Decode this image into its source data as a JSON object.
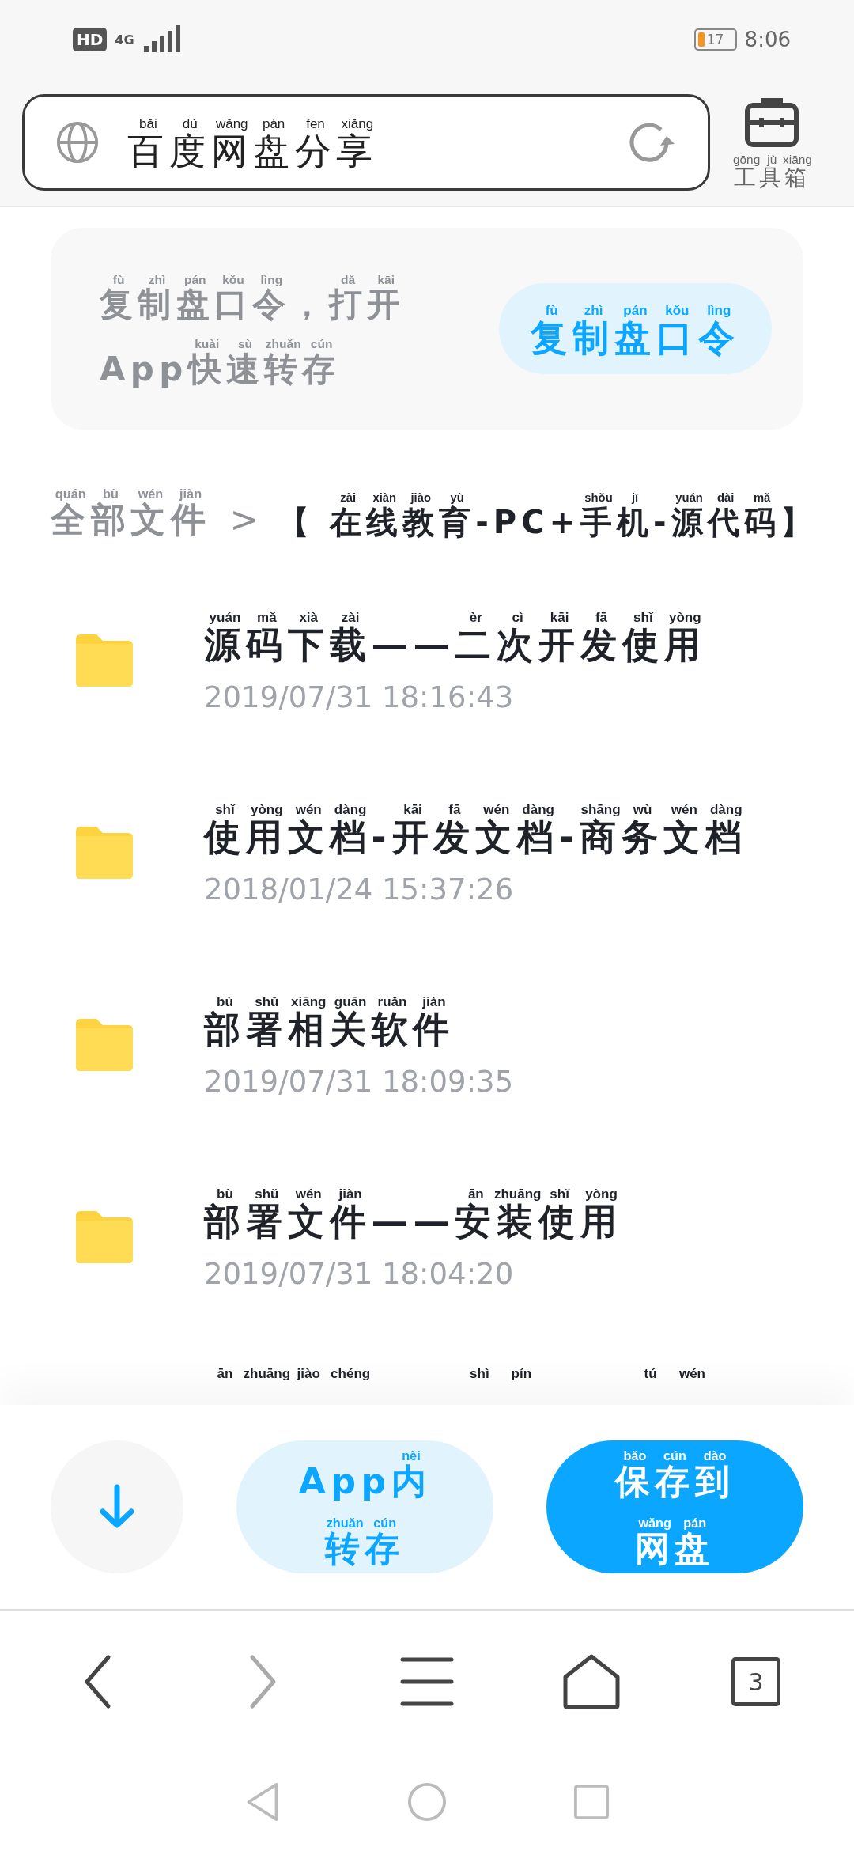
{
  "status_bar": {
    "hd": "HD",
    "network": "4G",
    "battery": "17",
    "time": "8:06"
  },
  "address_bar": {
    "title": [
      {
        "han": "百度网盘分享",
        "pinyin": [
          "bǎi",
          "dù",
          "wǎng",
          "pán",
          "fēn",
          "xiǎng"
        ]
      }
    ]
  },
  "toolbox": {
    "label": [
      {
        "han": "工具箱",
        "pinyin": [
          "gōng",
          "jù",
          "xiāng"
        ]
      }
    ]
  },
  "banner": {
    "lines": [
      [
        {
          "han": "复制盘口令",
          "pinyin": [
            "fù",
            "zhì",
            "pán",
            "kǒu",
            "lìng"
          ]
        },
        {
          "plain": "，"
        },
        {
          "han": "打开",
          "pinyin": [
            "dǎ",
            "kāi"
          ]
        }
      ],
      [
        {
          "plain": "App"
        },
        {
          "han": "快速转存",
          "pinyin": [
            "kuài",
            "sù",
            "zhuǎn",
            "cún"
          ]
        }
      ]
    ],
    "button": [
      {
        "han": "复制盘口令",
        "pinyin": [
          "fù",
          "zhì",
          "pán",
          "kǒu",
          "lìng"
        ]
      }
    ]
  },
  "breadcrumb": {
    "root": [
      {
        "han": "全部文件",
        "pinyin": [
          "quán",
          "bù",
          "wén",
          "jiàn"
        ]
      }
    ],
    "separator": ">",
    "current": [
      {
        "plain": "【 "
      },
      {
        "han": "在线教育",
        "pinyin": [
          "zài",
          "xiàn",
          "jiào",
          "yù"
        ]
      },
      {
        "plain": "-PC+"
      },
      {
        "han": "手机",
        "pinyin": [
          "shǒu",
          "jī"
        ]
      },
      {
        "plain": "-"
      },
      {
        "han": "源代码",
        "pinyin": [
          "yuán",
          "dài",
          "mǎ"
        ]
      },
      {
        "plain": "】"
      }
    ]
  },
  "files": [
    {
      "name": [
        {
          "han": "源码下载",
          "pinyin": [
            "yuán",
            "mǎ",
            "xià",
            "zài"
          ]
        },
        {
          "plain": "——"
        },
        {
          "han": "二次开发使用",
          "pinyin": [
            "èr",
            "cì",
            "kāi",
            "fā",
            "shǐ",
            "yòng"
          ]
        }
      ],
      "date": "2019/07/31 18:16:43"
    },
    {
      "name": [
        {
          "han": "使用文档",
          "pinyin": [
            "shǐ",
            "yòng",
            "wén",
            "dàng"
          ]
        },
        {
          "plain": "-"
        },
        {
          "han": "开发文档",
          "pinyin": [
            "kāi",
            "fā",
            "wén",
            "dàng"
          ]
        },
        {
          "plain": "-"
        },
        {
          "han": "商务文档",
          "pinyin": [
            "shāng",
            "wù",
            "wén",
            "dàng"
          ]
        }
      ],
      "date": "2018/01/24 15:37:26"
    },
    {
      "name": [
        {
          "han": "部署相关软件",
          "pinyin": [
            "bù",
            "shǔ",
            "xiāng",
            "guān",
            "ruǎn",
            "jiàn"
          ]
        }
      ],
      "date": "2019/07/31 18:09:35"
    },
    {
      "name": [
        {
          "han": "部署文件",
          "pinyin": [
            "bù",
            "shǔ",
            "wén",
            "jiàn"
          ]
        },
        {
          "plain": "——"
        },
        {
          "han": "安装使用",
          "pinyin": [
            "ān",
            "zhuāng",
            "shǐ",
            "yòng"
          ]
        }
      ],
      "date": "2019/07/31 18:04:20"
    },
    {
      "name": [
        {
          "pinyin": [
            "ān",
            "zhuāng",
            "jiào",
            "chéng"
          ]
        },
        {
          "pinyin": [
            "shì",
            "pín"
          ]
        },
        {
          "pinyin": [
            "tú",
            "wén"
          ]
        }
      ]
    }
  ],
  "actions": [
    {
      "kind": "download"
    },
    {
      "kind": "secondary",
      "lines": [
        [
          {
            "plain": "App"
          },
          {
            "han": "内",
            "pinyin": [
              "nèi"
            ]
          }
        ],
        [
          {
            "han": "转存",
            "pinyin": [
              "zhuǎn",
              "cún"
            ]
          }
        ]
      ]
    },
    {
      "kind": "primary",
      "lines": [
        [
          {
            "han": "保存到",
            "pinyin": [
              "bǎo",
              "cún",
              "dào"
            ]
          }
        ],
        [
          {
            "han": "网盘",
            "pinyin": [
              "wǎng",
              "pán"
            ]
          }
        ]
      ]
    }
  ],
  "browser_nav": [
    {
      "kind": "back",
      "disabled": false
    },
    {
      "kind": "forward",
      "disabled": true
    },
    {
      "kind": "menu",
      "disabled": false
    },
    {
      "kind": "home",
      "disabled": false
    },
    {
      "kind": "tabs",
      "disabled": false,
      "count": "3"
    }
  ]
}
